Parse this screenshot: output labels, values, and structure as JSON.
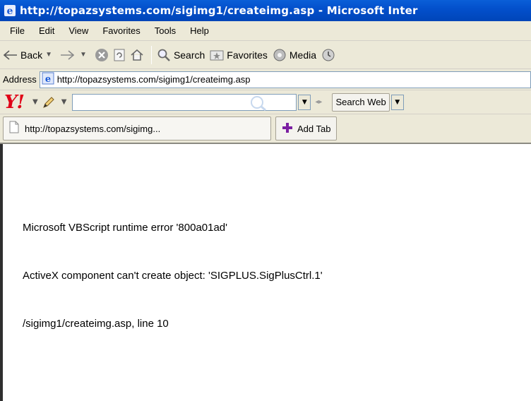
{
  "window": {
    "title": "http://topazsystems.com/sigimg1/createimg.asp - Microsoft Inter"
  },
  "menu": [
    "File",
    "Edit",
    "View",
    "Favorites",
    "Tools",
    "Help"
  ],
  "toolbar": {
    "back_label": "Back",
    "search_label": "Search",
    "favorites_label": "Favorites",
    "media_label": "Media"
  },
  "address": {
    "label": "Address",
    "url": "http://topazsystems.com/sigimg1/createimg.asp"
  },
  "yahoo": {
    "logo": "Y!",
    "search_value": "",
    "search_button_label": "Search Web"
  },
  "tabs": {
    "active_tab_label": "http://topazsystems.com/sigimg...",
    "add_tab_label": "Add Tab"
  },
  "page": {
    "error_line": "Microsoft VBScript runtime error '800a01ad'",
    "message_line": "ActiveX component can't create object: 'SIGPLUS.SigPlusCtrl.1'",
    "location_line": "/sigimg1/createimg.asp, line 10"
  },
  "icons": {
    "title": "ie-logo-icon",
    "back": "back-arrow-icon",
    "forward": "forward-arrow-icon",
    "stop": "stop-icon",
    "refresh": "refresh-icon",
    "home": "home-icon",
    "search": "magnifier-icon",
    "favorites": "favorites-star-icon",
    "media": "media-icon",
    "address_page": "ie-page-icon",
    "pencil": "pencil-icon",
    "tab_page": "blank-page-icon",
    "add_tab": "plus-icon"
  },
  "colors": {
    "titlebar": "#0350cc",
    "chrome": "#ece9d8",
    "yahoo_red": "#e00016",
    "add_tab_plus": "#7b1fa2"
  }
}
